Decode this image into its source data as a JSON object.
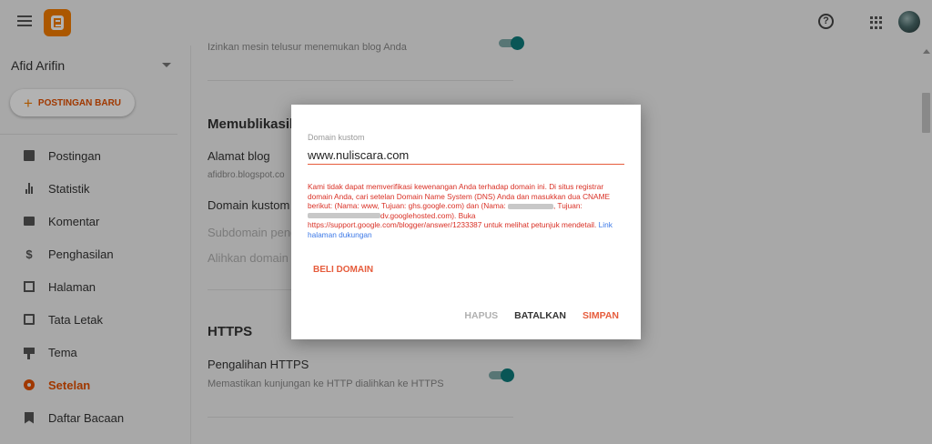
{
  "sidebar": {
    "blog_name": "Afid Arifin",
    "new_post_label": "POSTINGAN BARU",
    "items": [
      {
        "label": "Postingan"
      },
      {
        "label": "Statistik"
      },
      {
        "label": "Komentar"
      },
      {
        "label": "Penghasilan"
      },
      {
        "label": "Halaman"
      },
      {
        "label": "Tata Letak"
      },
      {
        "label": "Tema"
      },
      {
        "label": "Setelan"
      },
      {
        "label": "Daftar Bacaan"
      }
    ]
  },
  "main": {
    "search_desc": "Izinkan mesin telusur menemukan blog Anda",
    "publishing_heading": "Memublikasika",
    "blog_address_label": "Alamat blog",
    "blog_address_value": "afidbro.blogspot.co",
    "custom_domain_label": "Domain kustom",
    "subdomain_label": "Subdomain peng",
    "redirect_label": "Alihkan domain",
    "https_heading": "HTTPS",
    "https_redirect_label": "Pengalihan HTTPS",
    "https_redirect_desc": "Memastikan kunjungan ke HTTP dialihkan ke HTTPS"
  },
  "dialog": {
    "field_label": "Domain kustom",
    "field_value": "www.nuliscara.com",
    "error_part1": "Kami tidak dapat memverifikasi kewenangan Anda terhadap domain ini. Di situs registrar domain Anda, cari setelan Domain Name System (DNS) Anda dan masukkan dua CNAME berikut: (Nama: www, Tujuan: ghs.google.com) dan (Nama: ",
    "error_part2": ", Tujuan: ",
    "error_part3": "dv.googlehosted.com). Buka https://support.google.com/blogger/answer/1233387 untuk melihat petunjuk mendetail.",
    "error_link": "Link halaman dukungan",
    "buy_domain_label": "BELI DOMAIN",
    "delete_label": "HAPUS",
    "cancel_label": "BATALKAN",
    "save_label": "SIMPAN"
  },
  "icons": {
    "menu": "hamburger-menu-icon",
    "logo": "blogger-logo",
    "help": "help-icon",
    "apps": "apps-grid-icon",
    "avatar": "user-avatar"
  },
  "colors": {
    "accent": "#e65100",
    "dialog_accent": "#e65c3c",
    "error_text": "#d93025",
    "link": "#3b78e7",
    "toggle_on": "#0d7c7c"
  }
}
